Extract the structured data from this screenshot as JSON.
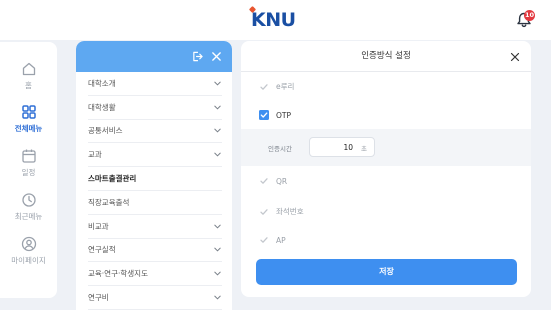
{
  "header": {
    "logo_text": "KNU",
    "notification_count": "10"
  },
  "leftnav": {
    "items": [
      {
        "label": "홈",
        "icon": "home-icon",
        "active": false
      },
      {
        "label": "전체메뉴",
        "icon": "grid-icon",
        "active": true
      },
      {
        "label": "일정",
        "icon": "calendar-icon",
        "active": false
      },
      {
        "label": "최근메뉴",
        "icon": "clock-icon",
        "active": false
      },
      {
        "label": "마이페이지",
        "icon": "user-icon",
        "active": false
      }
    ]
  },
  "menu": {
    "header_icons": [
      "logout-icon",
      "close-icon"
    ],
    "items": [
      {
        "label": "대학소개",
        "expandable": true
      },
      {
        "label": "대학생활",
        "expandable": true
      },
      {
        "label": "공통서비스",
        "expandable": true
      },
      {
        "label": "교과",
        "expandable": true
      },
      {
        "label": "스마트출결관리",
        "expandable": false
      },
      {
        "label": "직장교육출석",
        "expandable": false
      },
      {
        "label": "비교과",
        "expandable": true
      },
      {
        "label": "연구실적",
        "expandable": true
      },
      {
        "label": "교육·연구·학생지도",
        "expandable": true
      },
      {
        "label": "연구비",
        "expandable": true
      }
    ]
  },
  "settings": {
    "title": "인증방식 설정",
    "options": [
      {
        "label": "e루리",
        "checked": false
      },
      {
        "label": "OTP",
        "checked": true
      },
      {
        "label": "QR",
        "checked": false
      },
      {
        "label": "좌석번호",
        "checked": false
      },
      {
        "label": "AP",
        "checked": false
      }
    ],
    "auth_time": {
      "label": "인증시간",
      "value": "10",
      "unit": "초"
    },
    "save_label": "저장"
  },
  "colors": {
    "accent": "#3e8ff0",
    "menu_header": "#5ea8f1",
    "logo": "#1a4fa3",
    "badge": "#e2383f",
    "background": "#eef1f6"
  }
}
